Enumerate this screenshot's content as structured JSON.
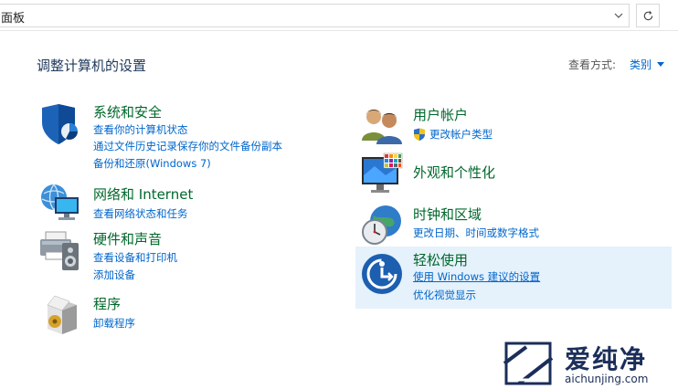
{
  "address_bar": {
    "path_text": "面板",
    "dropdown_icon": "chevron-down-icon",
    "refresh_icon": "refresh-icon"
  },
  "header": {
    "title": "调整计算机的设置",
    "view_by_label": "查看方式:",
    "view_by_value": "类别"
  },
  "categories": [
    {
      "title": "系统和安全",
      "icon": "system-security-shield-icon",
      "links": [
        "查看你的计算机状态",
        "通过文件历史记录保存你的文件备份副本",
        "备份和还原(Windows 7)"
      ]
    },
    {
      "title": "网络和 Internet",
      "icon": "network-globe-icon",
      "links": [
        "查看网络状态和任务"
      ]
    },
    {
      "title": "硬件和声音",
      "icon": "printer-speaker-icon",
      "links": [
        "查看设备和打印机",
        "添加设备"
      ]
    },
    {
      "title": "程序",
      "icon": "programs-box-icon",
      "links": [
        "卸载程序"
      ]
    },
    {
      "title": "用户帐户",
      "icon": "user-accounts-icon",
      "links": [
        "更改帐户类型"
      ]
    },
    {
      "title": "外观和个性化",
      "icon": "monitor-palette-icon",
      "links": []
    },
    {
      "title": "时钟和区域",
      "icon": "clock-globe-icon",
      "links": [
        "更改日期、时间或数字格式"
      ]
    },
    {
      "title": "轻松使用",
      "icon": "ease-of-access-icon",
      "links": [
        "使用 Windows 建议的设置",
        "优化视觉显示"
      ]
    }
  ],
  "watermark": {
    "text_cn": "爱纯净",
    "text_en": "aichunjing.com"
  },
  "colors": {
    "category_title": "#00682b",
    "link": "#0066cc",
    "heading": "#1e395b",
    "hover_bg": "#e5f1fb"
  }
}
